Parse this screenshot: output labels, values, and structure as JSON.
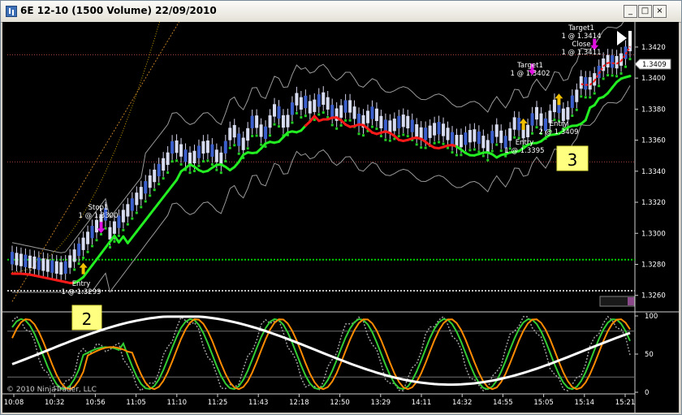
{
  "window": {
    "title": "6E 12-10 (1500 Volume)  22/09/2010",
    "minimize_glyph": "_",
    "maximize_glyph": "□",
    "close_glyph": "×"
  },
  "copyright": "© 2010 NinjaTrader, LLC",
  "play_icon": "skip-to-end-icon",
  "chart_data": [
    {
      "type": "line",
      "panel": "price",
      "instrument": "6E 12-10",
      "y_ticks": [
        "1.3420",
        "1.3400",
        "1.3380",
        "1.3360",
        "1.3340",
        "1.3320",
        "1.3300",
        "1.3280",
        "1.3260"
      ],
      "ylim": [
        1.3252,
        1.3432
      ],
      "current_price_label": "1.3409",
      "current_price": 1.3409,
      "annotations": [
        {
          "lines": [
            "Stop1",
            "1 @ 1.3300"
          ],
          "price": 1.33,
          "bar": 20
        },
        {
          "lines": [
            "Entry",
            "1 @ 1.3299"
          ],
          "price": 1.3283,
          "bar": 16
        },
        {
          "lines": [
            "Target1",
            "1 @ 1.3402"
          ],
          "price": 1.3402,
          "bar": 117
        },
        {
          "lines": [
            "Entry",
            "2 @ 1.3409"
          ],
          "price": 1.3385,
          "bar": 123
        },
        {
          "lines": [
            "Entry",
            "1 @ 1.3395"
          ],
          "price": 1.3375,
          "bar": 115
        },
        {
          "lines": [
            "Target1",
            "1 @ 1.3414",
            "Close",
            "1 @ 1.3411"
          ],
          "price": 1.3414,
          "bar": 131
        }
      ],
      "labels_boxes": [
        "3"
      ],
      "series_colors": {
        "ema_fast": "#00ff00",
        "ema_rising": "#00ff00",
        "ema_falling": "#ff0000",
        "dots": "#00cc00",
        "bands": "#c8c8c8",
        "slow_ma": "#d08a2a"
      }
    },
    {
      "type": "line",
      "panel": "stochastic",
      "y_ticks": [
        "100",
        "50",
        "0"
      ],
      "ylim": [
        0,
        100
      ],
      "x_ticks": [
        "10:08",
        "10:32",
        "10:56",
        "11:05",
        "11:10",
        "11:25",
        "11:43",
        "12:18",
        "12:50",
        "13:29",
        "14:11",
        "14:32",
        "14:55",
        "15:05",
        "15:14",
        "15:21"
      ],
      "labels_boxes": [
        "2"
      ],
      "series": [
        {
          "name": "",
          "color": "#ffffff"
        },
        {
          "name": "",
          "color": "#ff8c00"
        },
        {
          "name": "",
          "color": "#32cd32"
        },
        {
          "name": "",
          "color": "#a0a0a0"
        }
      ]
    }
  ]
}
